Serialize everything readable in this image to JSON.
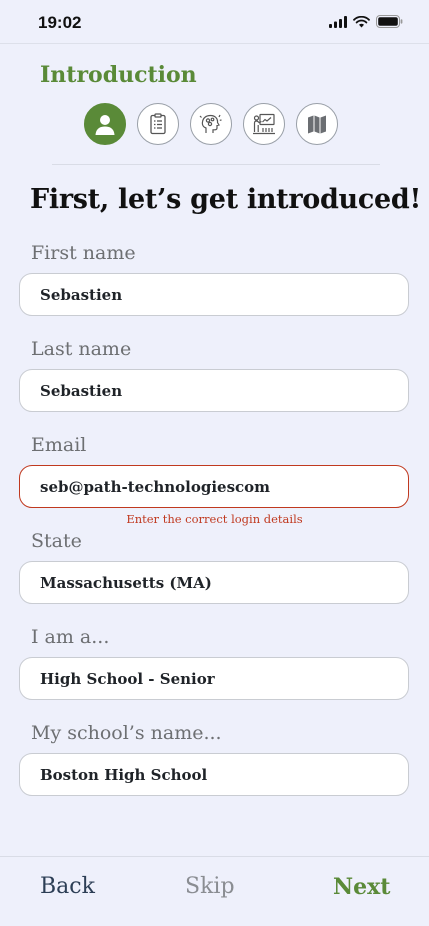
{
  "status_bar": {
    "time": "19:02"
  },
  "section_title": "Introduction",
  "steps": [
    {
      "icon": "person-icon",
      "active": true
    },
    {
      "icon": "clipboard-icon",
      "active": false
    },
    {
      "icon": "brain-icon",
      "active": false
    },
    {
      "icon": "presentation-icon",
      "active": false
    },
    {
      "icon": "map-icon",
      "active": false
    }
  ],
  "heading": "First, let’s get introduced!",
  "fields": {
    "first_name": {
      "label": "First name",
      "value": "Sebastien"
    },
    "last_name": {
      "label": "Last name",
      "value": "Sebastien"
    },
    "email": {
      "label": "Email",
      "value": "seb@path-technologiescom",
      "error": "Enter the correct login details"
    },
    "state": {
      "label": "State",
      "value": "Massachusetts (MA)"
    },
    "role": {
      "label": "I am a...",
      "value": "High School - Senior"
    },
    "school": {
      "label": "My school’s name...",
      "value": "Boston High School"
    }
  },
  "footer": {
    "back": "Back",
    "skip": "Skip",
    "next": "Next"
  },
  "colors": {
    "accent": "#5a8a38",
    "error": "#c0391f",
    "background": "#eef0fb"
  }
}
